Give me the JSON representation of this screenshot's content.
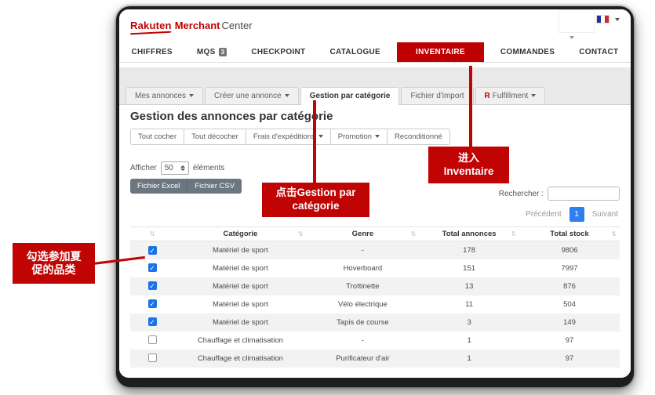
{
  "header": {
    "logo": {
      "rakuten": "Rakuten",
      "merchant": "Merchant",
      "center": "Center"
    }
  },
  "nav": {
    "items": [
      {
        "label": "CHIFFRES"
      },
      {
        "label": "MQS",
        "badge": "3"
      },
      {
        "label": "CHECKPOINT"
      },
      {
        "label": "CATALOGUE"
      },
      {
        "label": "INVENTAIRE",
        "active": true
      },
      {
        "label": "COMMANDES"
      },
      {
        "label": "CONTACT"
      }
    ]
  },
  "tabs": {
    "items": [
      {
        "label": "Mes annonces"
      },
      {
        "label": "Créer une annonce"
      },
      {
        "label": "Gestion par catégorie",
        "active": true
      },
      {
        "label": "Fichier d'import"
      },
      {
        "label": "Fulfillment",
        "icon_label": "R"
      }
    ]
  },
  "page": {
    "title": "Gestion des annonces par catégorie"
  },
  "filters": {
    "buttons": [
      {
        "label": "Tout cocher"
      },
      {
        "label": "Tout décocher"
      },
      {
        "label": "Frais d'expéditions"
      },
      {
        "label": "Promotion"
      },
      {
        "label": "Reconditionné"
      }
    ]
  },
  "display": {
    "before": "Afficher",
    "value": "50",
    "after": "éléments"
  },
  "export": {
    "excel": "Fichier Excel",
    "csv": "Fichier CSV"
  },
  "search": {
    "label": "Rechercher :",
    "value": ""
  },
  "pagination": {
    "previous": "Précédent",
    "current": "1",
    "next": "Suivant"
  },
  "table": {
    "sort_icon": "⇅",
    "columns": {
      "categorie": "Catégorie",
      "genre": "Genre",
      "total_annonces": "Total annonces",
      "total_stock": "Total stock"
    },
    "rows": [
      {
        "checked": true,
        "categorie": "Matériel de sport",
        "genre": "-",
        "total_annonces": "178",
        "total_stock": "9806"
      },
      {
        "checked": true,
        "categorie": "Matériel de sport",
        "genre": "Hoverboard",
        "total_annonces": "151",
        "total_stock": "7997"
      },
      {
        "checked": true,
        "categorie": "Matériel de sport",
        "genre": "Trottinette",
        "total_annonces": "13",
        "total_stock": "876"
      },
      {
        "checked": true,
        "categorie": "Matériel de sport",
        "genre": "Vélo électrique",
        "total_annonces": "11",
        "total_stock": "504"
      },
      {
        "checked": true,
        "categorie": "Matériel de sport",
        "genre": "Tapis de course",
        "total_annonces": "3",
        "total_stock": "149"
      },
      {
        "checked": false,
        "categorie": "Chauffage et climatisation",
        "genre": "-",
        "total_annonces": "1",
        "total_stock": "97"
      },
      {
        "checked": false,
        "categorie": "Chauffage et climatisation",
        "genre": "Purificateur d'air",
        "total_annonces": "1",
        "total_stock": "97"
      }
    ]
  },
  "annotations": {
    "enter_inventaire": {
      "line1": "进入",
      "line2": "Inventaire"
    },
    "click_category": {
      "line1": "点击Gestion par",
      "line2": "catégorie"
    },
    "check_categories": {
      "line1": "勾选参加夏",
      "line2": "促的品类"
    }
  },
  "colors": {
    "rakuten_red": "#bf0000",
    "annotation_red": "#c00303",
    "pagination_active": "#2e80f0",
    "checkbox_blue": "#1a73e8",
    "row_stripe": "#f2f2f2"
  }
}
